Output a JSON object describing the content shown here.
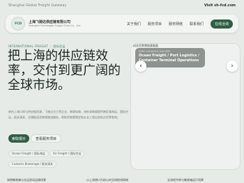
{
  "topbar": {
    "site_name": "Shanghai Global Freight Gateway",
    "visit_label": "Visit sh-fcd.com"
  },
  "header": {
    "logo_text": "FCD",
    "brand_cn": "上海飞驰达供应链有限公司",
    "brand_en": "Shanghai Feichengda Supply Chain Co., Ltd.",
    "nav": [
      "关于我们",
      "服务项目",
      "服务网络",
      "联系我们"
    ],
    "cta": "在线洽询"
  },
  "hero": {
    "kicker": "INTERNATIONAL FREIGHT ｜ 国际货运",
    "headline": "把上海的供应链效率，交付到更广阔的全球市场。",
    "description": "依托上海口岸与供应链资源，飞驰达为工贸企业、跨境电商、海外采购商提供跨区域海运、国际空运、报关清关、仓储配送及跨境物流服务，帮助货物更稳定地从长三角出发抵达世界各地。",
    "primary_button": "索取报价",
    "secondary_button": "查看服务项目",
    "tags": [
      "Ocean Freight / 国际海运",
      "Air Freight / 国际空运",
      "Customs Brokerage / 报关清关"
    ]
  },
  "gallery": {
    "alt_text": "码头世界港航意图面",
    "caption_kicker": "PORT LOGISTICS GALLERY",
    "caption_title": "Ocean Freight / Port Logistics / Container Terminal Operations",
    "prev_icon": "‹",
    "next_icon": "›"
  },
  "bottom_strip": [
    "海港集装箱与交运驳动运输场景",
    "以上海港口为核心的全球航线网络",
    "全流程中转与集装箱运行场景"
  ]
}
